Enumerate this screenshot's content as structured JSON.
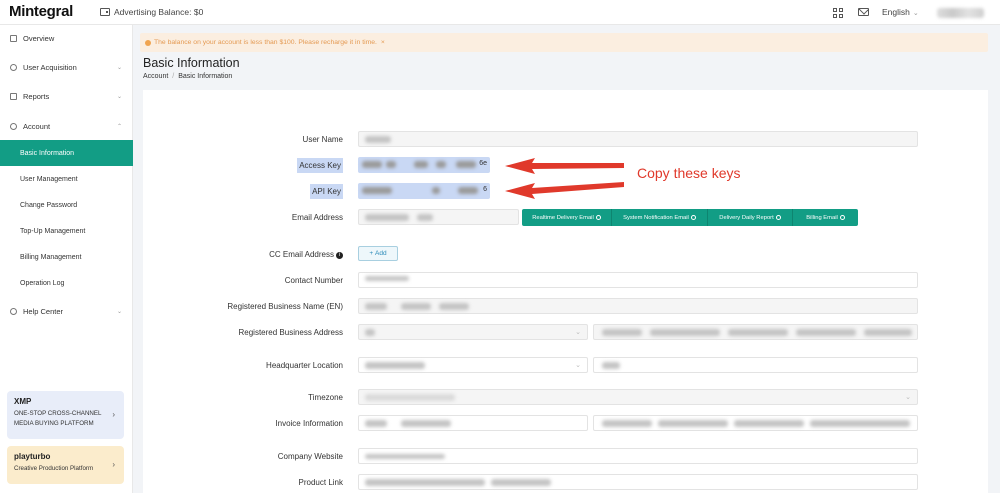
{
  "header": {
    "logo": "Mintegral",
    "balance_label": "Advertising Balance: $0",
    "language": "English"
  },
  "sidebar": {
    "items": [
      {
        "label": "Overview",
        "icon": "overview-icon"
      },
      {
        "label": "User Acquisition",
        "icon": "users-icon"
      },
      {
        "label": "Reports",
        "icon": "reports-icon"
      },
      {
        "label": "Account",
        "icon": "gear-icon"
      },
      {
        "label": "Help Center",
        "icon": "help-icon"
      }
    ],
    "account_sub": [
      "Basic Information",
      "User Management",
      "Change Password",
      "Top-Up Management",
      "Billing Management",
      "Operation Log"
    ],
    "promos": [
      {
        "brand": "XMP",
        "text": "ONE-STOP CROSS-CHANNEL MEDIA BUYING PLATFORM"
      },
      {
        "brand": "playturbo",
        "text": "Creative Production Platform"
      }
    ]
  },
  "alert": {
    "text": "The balance on your account is less than $100. Please recharge it in time.",
    "close": "×"
  },
  "page": {
    "title": "Basic Information",
    "breadcrumb": [
      "Account",
      "Basic Information"
    ]
  },
  "form": {
    "labels": {
      "user_name": "User Name",
      "access_key": "Access Key",
      "api_key": "API Key",
      "email": "Email Address",
      "cc_email": "CC Email Address",
      "contact": "Contact Number",
      "reg_name": "Registered Business Name (EN)",
      "reg_address": "Registered Business Address",
      "hq": "Headquarter Location",
      "timezone": "Timezone",
      "invoice": "Invoice Information",
      "website": "Company Website",
      "product": "Product Link"
    },
    "access_key_tail": "6e",
    "api_key_tail": "6",
    "add_button": "Add",
    "email_tabs": [
      "Realtime Delivery Email",
      "System Notification Email",
      "Delivery Daily Report",
      "Billing Email"
    ]
  },
  "annotation": "Copy these keys",
  "colors": {
    "accent": "#129d85",
    "highlight": "#c9d8f4",
    "annotation": "#e0392b",
    "alert_bg": "#fbeee0"
  }
}
